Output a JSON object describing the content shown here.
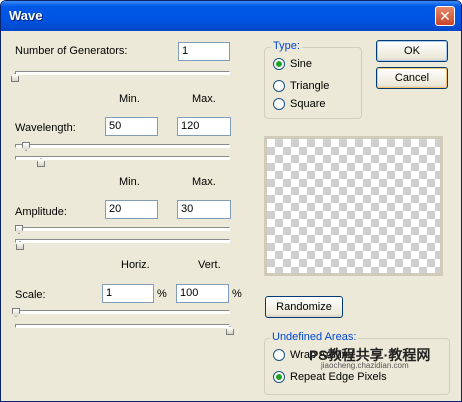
{
  "window": {
    "title": "Wave",
    "close_glyph": "✕"
  },
  "generators": {
    "label": "Number of Generators:",
    "value": "1"
  },
  "col_headers_1": {
    "min": "Min.",
    "max": "Max."
  },
  "wavelength": {
    "label": "Wavelength:",
    "min": "50",
    "max": "120"
  },
  "col_headers_2": {
    "min": "Min.",
    "max": "Max."
  },
  "amplitude": {
    "label": "Amplitude:",
    "min": "20",
    "max": "30"
  },
  "scale_headers": {
    "horiz": "Horiz.",
    "vert": "Vert."
  },
  "scale": {
    "label": "Scale:",
    "horiz": "1",
    "vert": "100",
    "unit": "%"
  },
  "type_group": {
    "legend": "Type:",
    "options": [
      {
        "label": "Sine",
        "selected": true
      },
      {
        "label": "Triangle",
        "selected": false
      },
      {
        "label": "Square",
        "selected": false
      }
    ]
  },
  "buttons": {
    "ok": "OK",
    "cancel": "Cancel",
    "randomize": "Randomize"
  },
  "undefined_areas": {
    "legend": "Undefined Areas:",
    "options": [
      {
        "label": "Wrap Around",
        "selected": false
      },
      {
        "label": "Repeat Edge Pixels",
        "selected": true
      }
    ]
  },
  "watermark": {
    "brand": "PS教程共享·教程网",
    "url": "jiaocheng.chazidian.com"
  },
  "colors": {
    "title_blue": "#0054e3",
    "legend_blue": "#0046d5",
    "radio_green": "#21a121"
  }
}
